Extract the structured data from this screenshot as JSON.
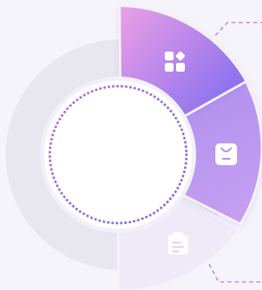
{
  "colors": {
    "background": "#f6f4fb",
    "track": "#e8e6ef",
    "segment_1_start": "#ea9fe6",
    "segment_1_end": "#7e6af0",
    "segment_2_start": "#b191ef",
    "segment_2_end": "#c8a0f0",
    "segment_3": "#eeeaf8",
    "separator": "#f4f2fa",
    "inner_dots_start": "#c06ad8",
    "inner_dots_end": "#7f6ae8",
    "connector": "#d07cdc",
    "icon": "#ffffff"
  },
  "segments": [
    {
      "id": "segment-1",
      "icon": "apps-grid-icon",
      "state": "highlighted"
    },
    {
      "id": "segment-2",
      "icon": "shopping-bag-icon",
      "state": "highlighted"
    },
    {
      "id": "segment-3",
      "icon": "clipboard-icon",
      "state": "faded"
    }
  ]
}
